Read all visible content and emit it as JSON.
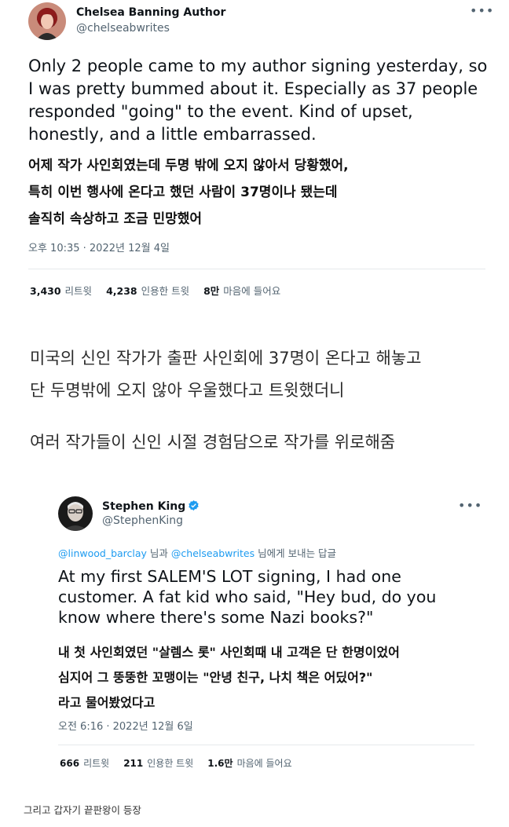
{
  "tweet1": {
    "author_name": "Chelsea Banning Author",
    "author_handle": "@chelseabwrites",
    "text_en": "Only 2 people came to my author signing yesterday, so I was pretty bummed about it. Especially as 37 people responded \"going\" to the event. Kind of upset, honestly, and a little embarrassed.",
    "text_ko_lines": [
      "어제 작가 사인회였는데 두명 밖에 오지 않아서 당황했어,",
      "특히 이번 행사에 온다고 했던 사람이 37명이나 됐는데",
      "솔직히 속상하고 조금 민망했어"
    ],
    "timestamp": "오후 10:35 · 2022년 12월 4일",
    "stats": [
      {
        "count": "3,430",
        "label": "리트윗"
      },
      {
        "count": "4,238",
        "label": "인용한 트윗"
      },
      {
        "count": "8만",
        "label": "마음에 들어요"
      }
    ]
  },
  "caption": {
    "lines": [
      "미국의 신인 작가가 출판 사인회에 37명이 온다고 해놓고",
      "단 두명밖에 오지 않아 우울했다고 트윗했더니",
      "여러 작가들이 신인 시절 경험담으로 작가를 위로해줌"
    ]
  },
  "tweet2": {
    "author_name": "Stephen King",
    "author_handle": "@StephenKing",
    "reply_mention_1": "@linwood_barclay",
    "reply_and": "님과",
    "reply_mention_2": "@chelseabwrites",
    "reply_suffix": "님에게 보내는 답글",
    "text_en": "At my first SALEM'S LOT signing, I had one customer. A fat kid who said, \"Hey bud, do you know where there's some Nazi books?\"",
    "text_ko_lines": [
      "내 첫 사인회였던 \"살렘스 롯\" 사인회때 내 고객은 단 한명이었어",
      "심지어 그 뚱뚱한 꼬맹이는 \"안녕 친구, 나치 책은 어딨어?\"",
      "라고 물어봤었다고"
    ],
    "timestamp": "오전 6:16 · 2022년 12월 6일",
    "stats": [
      {
        "count": "666",
        "label": "리트윗"
      },
      {
        "count": "211",
        "label": "인용한 트윗"
      },
      {
        "count": "1.6만",
        "label": "마음에 들어요"
      }
    ]
  },
  "footer": {
    "text": "그리고 갑자기 끝판왕이 등장"
  },
  "colors": {
    "link": "#1d9bf0",
    "verified": "#1d9bf0",
    "secondary_text": "#536471"
  }
}
